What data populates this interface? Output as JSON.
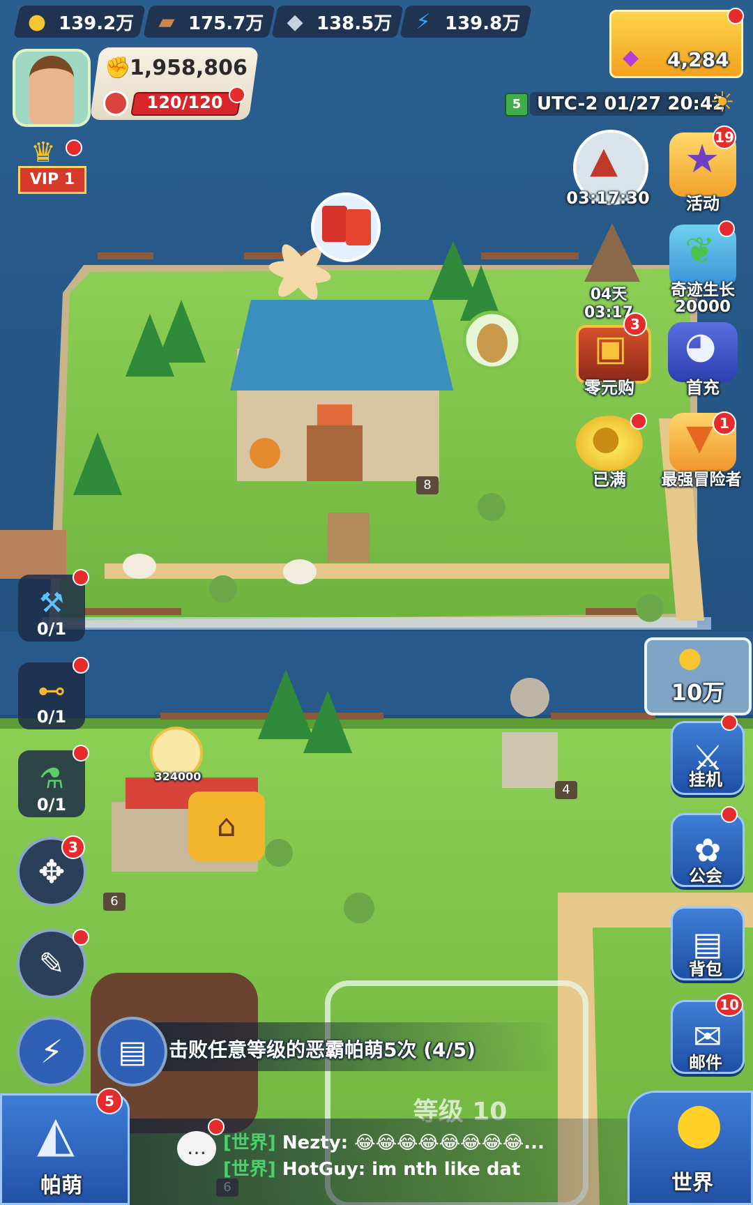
{
  "resources": [
    {
      "icon": "gold-coin-icon",
      "value": "139.2万"
    },
    {
      "icon": "wood-icon",
      "value": "175.7万"
    },
    {
      "icon": "ore-icon",
      "value": "138.5万"
    },
    {
      "icon": "energy-icon",
      "value": "139.8万"
    }
  ],
  "player": {
    "power": "1,958,806",
    "stamina": "120/120",
    "vip": "VIP 1"
  },
  "shop_gems": "4,284",
  "clock": {
    "calendar_day": "5",
    "text": "UTC-2 01/27 20:42"
  },
  "right_events": [
    {
      "label": "03:17:30",
      "badge": ""
    },
    {
      "label": "活动",
      "badge": "19"
    },
    {
      "label": "04天 03:17",
      "badge": ""
    },
    {
      "label": "奇迹生长\n20000",
      "badge": "dot"
    },
    {
      "label": "零元购",
      "badge": "3"
    },
    {
      "label": "首充",
      "badge": ""
    },
    {
      "label": "已满",
      "badge": "dot"
    },
    {
      "label": "最强冒险者",
      "badge": "1"
    }
  ],
  "left_buttons": [
    {
      "icon": "hammer-icon",
      "count": "0/1"
    },
    {
      "icon": "dumbbell-icon",
      "count": "0/1"
    },
    {
      "icon": "flask-icon",
      "count": "0/1"
    }
  ],
  "round_badges": {
    "weathervane": "3"
  },
  "coin_collect": "10万",
  "right_menu": [
    {
      "label": "挂机",
      "badge": "dot"
    },
    {
      "label": "公会",
      "badge": "dot"
    },
    {
      "label": "背包",
      "badge": ""
    },
    {
      "label": "邮件",
      "badge": "10"
    }
  ],
  "map": {
    "house_level": "8",
    "statue_level": "4",
    "market_level": "6",
    "market_coins": "324000",
    "bottom_level": "6",
    "plot_label": "等级 10"
  },
  "quest": "击败任意等级的恶霸帕萌5次 (4/5)",
  "bottom": {
    "pal_label": "帕萌",
    "pal_badge": "5",
    "world_label": "世界"
  },
  "chat": [
    {
      "channel": "[世界]",
      "user": "Nezty:",
      "msg": "😂😂😂😂😂😂😂😂..."
    },
    {
      "channel": "[世界]",
      "user": "HotGuy:",
      "msg": "im nth like dat"
    }
  ],
  "colors": {
    "grass": "#7ec34a",
    "water": "#1f4d7a",
    "path": "#e6c98a",
    "accent_red": "#e52b2b",
    "button_blue": "#2f66c0"
  }
}
